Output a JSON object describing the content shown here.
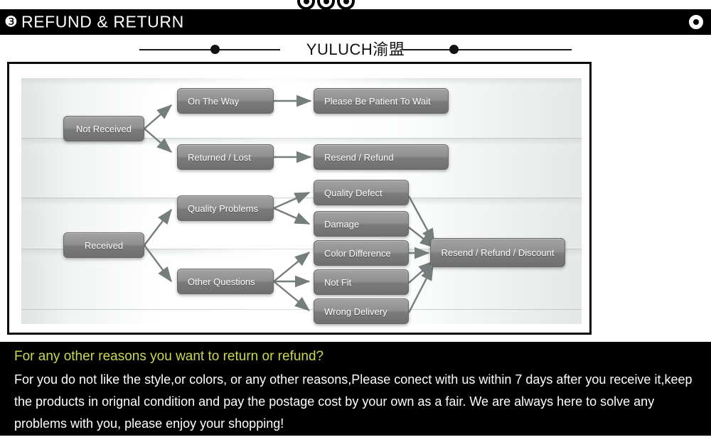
{
  "header": {
    "badge": "❸",
    "title": "REFUND & RETURN",
    "dot_icons": [
      "header-dot-1",
      "header-dot-2",
      "header-dot-3"
    ],
    "ring_icon": "header-ring-icon"
  },
  "brand": {
    "text": "YULUCH渝盟"
  },
  "diagram": {
    "boxes": [
      {
        "id": "not-received",
        "label": "Not Received"
      },
      {
        "id": "on-the-way",
        "label": "On The Way"
      },
      {
        "id": "returned-lost",
        "label": "Returned / Lost"
      },
      {
        "id": "please-be-patient",
        "label": "Please Be Patient To Wait"
      },
      {
        "id": "resend-refund",
        "label": "Resend / Refund"
      },
      {
        "id": "received",
        "label": "Received"
      },
      {
        "id": "quality-problems",
        "label": "Quality Problems"
      },
      {
        "id": "other-questions",
        "label": "Other Questions"
      },
      {
        "id": "quality-defect",
        "label": "Quality Defect"
      },
      {
        "id": "damage",
        "label": "Damage"
      },
      {
        "id": "color-difference",
        "label": "Color Difference"
      },
      {
        "id": "not-fit",
        "label": "Not Fit"
      },
      {
        "id": "wrong-delivery",
        "label": "Wrong Delivery"
      },
      {
        "id": "resend-refund-discount",
        "label": "Resend / Refund / Discount"
      }
    ]
  },
  "footer": {
    "heading": "For any other reasons you want to return or refund?",
    "body": "For you do not like the style,or colors, or any other reasons,Please conect with us within 7 days after you receive it,keep the products in orignal condition and pay the postage cost by your own as a fair. We are always here to solve any problems with you, please enjoy your shopping!"
  },
  "colors": {
    "header_bg": "#000000",
    "accent_yellow_green": "#c9d94b",
    "box_fill": "#8c8c8c",
    "arrow": "#767d7d"
  }
}
